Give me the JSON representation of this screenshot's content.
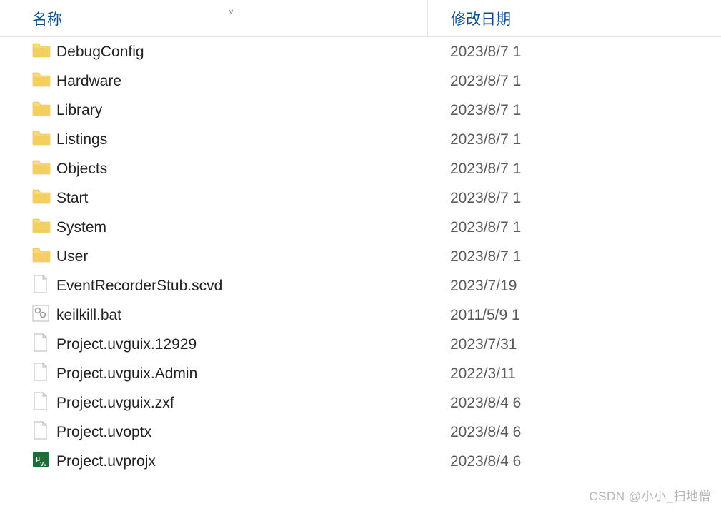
{
  "header": {
    "col_name": "名称",
    "col_date": "修改日期"
  },
  "files": [
    {
      "name": "DebugConfig",
      "date": "2023/8/7 1",
      "icon": "folder"
    },
    {
      "name": "Hardware",
      "date": "2023/8/7 1",
      "icon": "folder"
    },
    {
      "name": "Library",
      "date": "2023/8/7 1",
      "icon": "folder"
    },
    {
      "name": "Listings",
      "date": "2023/8/7 1",
      "icon": "folder"
    },
    {
      "name": "Objects",
      "date": "2023/8/7 1",
      "icon": "folder"
    },
    {
      "name": "Start",
      "date": "2023/8/7 1",
      "icon": "folder"
    },
    {
      "name": "System",
      "date": "2023/8/7 1",
      "icon": "folder"
    },
    {
      "name": "User",
      "date": "2023/8/7 1",
      "icon": "folder"
    },
    {
      "name": "EventRecorderStub.scvd",
      "date": "2023/7/19",
      "icon": "file"
    },
    {
      "name": "keilkill.bat",
      "date": "2011/5/9 1",
      "icon": "bat"
    },
    {
      "name": "Project.uvguix.12929",
      "date": "2023/7/31",
      "icon": "file"
    },
    {
      "name": "Project.uvguix.Admin",
      "date": "2022/3/11",
      "icon": "file"
    },
    {
      "name": "Project.uvguix.zxf",
      "date": "2023/8/4 6",
      "icon": "file"
    },
    {
      "name": "Project.uvoptx",
      "date": "2023/8/4 6",
      "icon": "file"
    },
    {
      "name": "Project.uvprojx",
      "date": "2023/8/4 6",
      "icon": "uv"
    }
  ],
  "watermark": "CSDN @小小_扫地僧"
}
